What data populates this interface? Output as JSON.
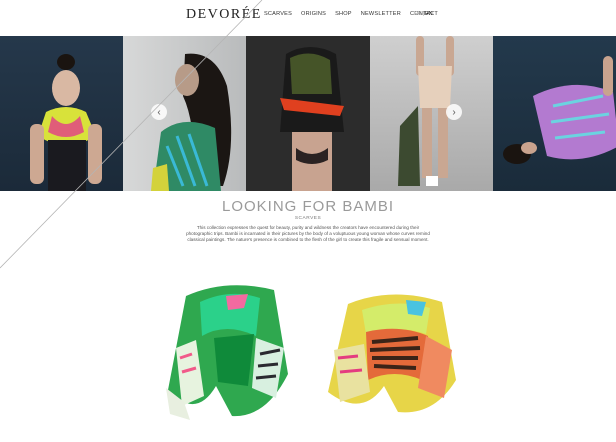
{
  "header": {
    "logo": "DEVORÉE",
    "nav": [
      "SCARVES",
      "ORIGINS",
      "SHOP",
      "NEWSLETTER",
      "CONTACT"
    ],
    "lang_fr": "FR",
    "lang_sep": "|",
    "lang_en": "EN"
  },
  "collection": {
    "title": "LOOKING FOR BAMBI",
    "category": "SCARVES",
    "description": "This collection expresses the quest for beauty, purity and wildness the creators have encountered during their photographic trips. Bambi is incarnated in their pictures by the body of a voluptuous young woman whose curves remind classical paintings. The nature's presence is combined to the flesh of the girl to create this fragile and sensual moment."
  },
  "slider": {
    "prev_icon": "chevron-left-icon",
    "next_icon": "chevron-right-icon"
  },
  "colors": {
    "accent_text": "#9a9a9a",
    "panel_dark": "#1b2a39"
  }
}
